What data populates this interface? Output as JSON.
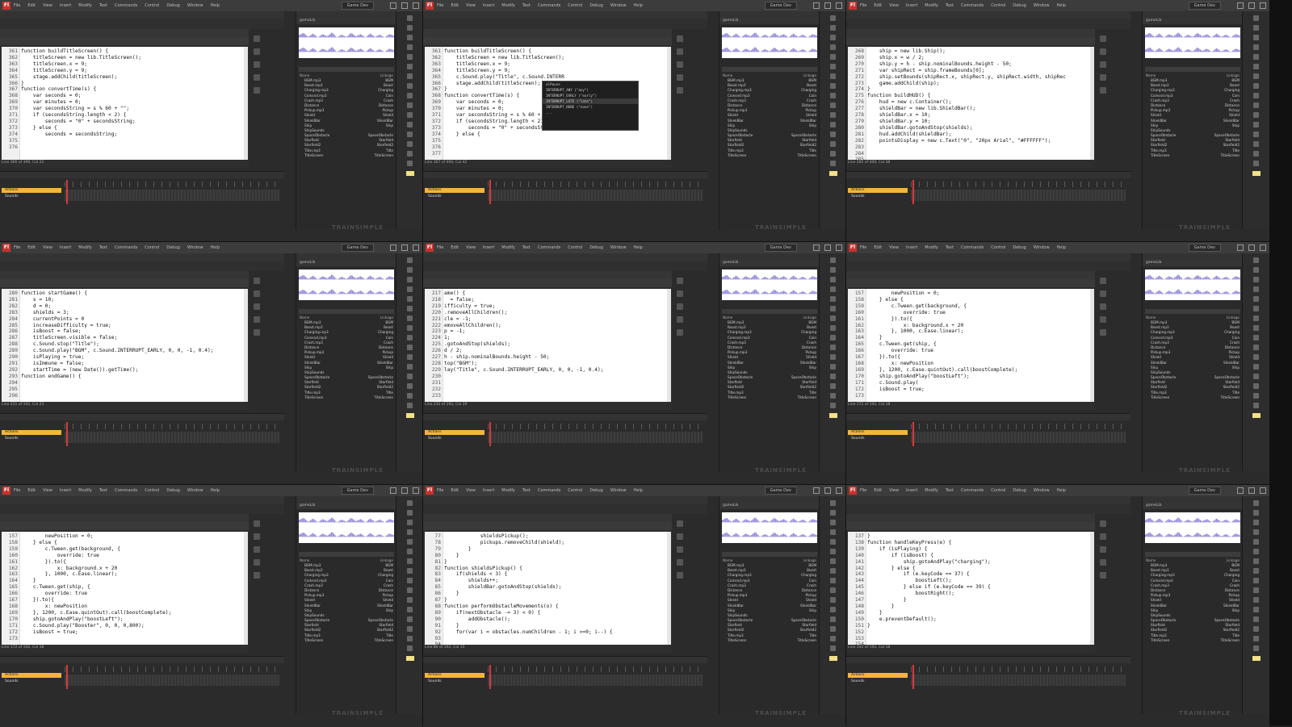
{
  "app": {
    "menu": [
      "File",
      "Edit",
      "View",
      "Insert",
      "Modify",
      "Text",
      "Commands",
      "Control",
      "Debug",
      "Window",
      "Help"
    ],
    "workspace": "Game Dev",
    "watermark": "TRAINSIMPLE",
    "accent": "#c8312c"
  },
  "tiles": [
    {
      "first_line": 361,
      "lines": [
        "",
        "function buildTitleScreen() {",
        "    titleScreen = new lib.TitleScreen();",
        "    titleScreen.x = 9;",
        "    titleScreen.y = 9;",
        "    stage.addChild(titleScreen);",
        "}",
        "",
        "function convertTime(s) {",
        "    var seconds = 0;",
        "    var minutes = 0;",
        "    var secondsString = s % 60 + \"\";",
        "    if (secondsString.length < 2) {",
        "        seconds = \"0\" + secondsString;",
        "    } else {",
        "        seconds = secondsString;"
      ],
      "status": "Line 366 of 399, Col 22"
    },
    {
      "first_line": 361,
      "lines": [
        "",
        "function buildTitleScreen() {",
        "    titleScreen = new lib.TitleScreen();",
        "    titleScreen.x = 9;",
        "    titleScreen.y = 9;",
        "    c.Sound.play(\"Title\", c.Sound.INTERR",
        "    stage.addChild(titleScreen);",
        "}",
        "",
        "",
        "function convertTime(s) {",
        "    var seconds = 0;",
        "    var minutes = 0;",
        "    var secondsString = s % 60 + \"\";",
        "    if (secondsString.length < 2) {",
        "        seconds = \"0\" + secondsString;",
        "    } else {"
      ],
      "status": "Line 367 of 400, Col 42",
      "autocomplete": [
        "alPause",
        "INTERRUPT_ANY (\"any\")",
        "INTERRUPT_EARLY (\"early\")",
        "INTERRUPT_LATE (\"late\")",
        "INTERRUPT_NONE (\"none\")",
        "..."
      ]
    },
    {
      "first_line": 268,
      "lines": [
        "    ship = new lib.Ship();",
        "    ship.x = w / 2;",
        "    ship.y = h - ship.nominalBounds.height - 50;",
        "    var shipRect = ship.frameBounds[0];",
        "    ship.setBounds(shipRect.x, shipRect.y, shipRect.width, shipRec",
        "    game.addChild(ship);",
        "}",
        "",
        "function buildHUD() {",
        "    hud = new c.Container();",
        "",
        "    shieldBar = new lib.ShieldBar();",
        "    shieldBar.x = 10;",
        "    shieldBar.y = 10;",
        "    shieldBar.gotoAndStop(shields);",
        "    hud.addChild(shieldBar);",
        "",
        "    pointsDisplay = new c.Text(\"0\", \"20px Arial\", \"#FFFFFF\");"
      ],
      "status": "Line 285 of 400, Col 48"
    },
    {
      "first_line": 280,
      "lines": [
        "",
        "",
        "function startGame() {",
        "    s = 10;",
        "    d = 0;",
        "    shields = 3;",
        "    currentPoints = 0",
        "    increaseDifficulty = true;",
        "    isBoost = false;",
        "    titleScreen.visible = false;",
        "    c.Sound.stop(\"Title\");",
        "    c.Sound.play(\"BGM\", c.Sound.INTERRUPT_EARLY, 0, 0, -1, 0.4);",
        "    isPlaying = true;",
        "    isImmune = false;",
        "    startTime = (new Date()).getTime();",
        "",
        "function endGame() {"
      ],
      "status": "Line 211 of 192, Col 23"
    },
    {
      "first_line": 217,
      "lines": [
        "ame() {",
        "  = false;",
        "",
        "ifficulty = true;",
        ".removeAllChildren();",
        "cle = -1;",
        "emoveAllChildren();",
        "p = -1;",
        "1;",
        ".gotoAndStop(shields);",
        "d / 2;",
        "h - ship.nominalBounds.height - 50;",
        "",
        "top(\"BGM\");",
        "lay(\"Title\", c.Sound.INTERRUPT_EARLY, 0, 0, -1, 0.4);",
        "",
        ""
      ],
      "status": "Line 232 of 192, Col 19"
    },
    {
      "first_line": 157,
      "lines": [
        "        newPosition = 0;",
        "    } else {",
        "        c.Tween.get(background, {",
        "            override: true",
        "        }).to({",
        "            x: background.x + 20",
        "        }, 1000, c.Ease.linear);",
        "    }",
        "",
        "    c.Tween.get(ship, {",
        "        override: true",
        "    }).to({",
        "        x: newPosition",
        "    }, 1200, c.Ease.quintOut).call(boostComplete);",
        "    ship.gotoAndPlay(\"boostLeft\");",
        "    c.Sound.play(",
        "    isBoost = true;"
      ],
      "status": "Line 172 of 192, Col 18"
    },
    {
      "first_line": 157,
      "lines": [
        "        newPosition = 0;",
        "    } else {",
        "        c.Tween.get(background, {",
        "            override: true",
        "        }).to({",
        "            x: background.x + 20",
        "        }, 1000, c.Ease.linear);",
        "    }",
        "",
        "    c.Tween.get(ship, {",
        "        override: true",
        "    }).to({",
        "        x: newPosition",
        "    }, 1200, c.Ease.quintOut).call(boostComplete);",
        "    ship.gotoAndPlay(\"boostLeft\");",
        "    c.Sound.play(\"Booster\", 0, 0, 0,800);",
        "    isBoost = true;"
      ],
      "status": "Line 172 of 192, Col 38"
    },
    {
      "first_line": 77,
      "lines": [
        "            shieldsPickup();",
        "            pickups.removeChild(shield);",
        "        }",
        "    }",
        "}",
        "",
        "function shieldsPickup() {",
        "    if(shields < 3) {",
        "        shields++;",
        "        shieldBar.gotoAndStop(shields);",
        "    }",
        "}",
        "",
        "function performObstacleMovements(o) {",
        "    if(nextObstacle -= 3) < 0) {",
        "        addObstacle();",
        "    }",
        "",
        "    for(var i = obstacles.numChildren - 1; i >=0; i--) {"
      ],
      "status": "Line 86 of 192, Col 15"
    },
    {
      "first_line": 137,
      "lines": [
        "}",
        "",
        "function handleKeyPress(e) {",
        "    if (isPlaying) {",
        "        if (isBoost) {",
        "            ship.gotoAndPlay(\"charging\");",
        "",
        "        } else {",
        "            if (e.keyCode == 37) {",
        "                boostLeft();",
        "            } else if (e.keyCode == 39) {",
        "                boostRight();",
        "            }",
        "        }",
        "    }",
        "    e.preventDefault();",
        "}",
        ""
      ],
      "status": "Line 141 of 192, Col 18"
    }
  ],
  "library": {
    "file": "gameLib",
    "header_name": "Name",
    "header_linkage": "Linkage",
    "items": [
      {
        "name": "BGM.mp3",
        "linkage": "BGM"
      },
      {
        "name": "Boost.mp3",
        "linkage": "Boost"
      },
      {
        "name": "Charging.mp3",
        "linkage": "Charging"
      },
      {
        "name": "Coinsnd.mp3",
        "linkage": "Coin"
      },
      {
        "name": "Crash.mp3",
        "linkage": "Crash"
      },
      {
        "name": "Distance",
        "linkage": "Distance"
      },
      {
        "name": "Pickup.mp3",
        "linkage": "Pickup"
      },
      {
        "name": "Shield",
        "linkage": "Shield"
      },
      {
        "name": "ShieldBar",
        "linkage": "ShieldBar"
      },
      {
        "name": "Ship",
        "linkage": "Ship"
      },
      {
        "name": "ShipSounds",
        "linkage": ""
      },
      {
        "name": "SpaceObstacle",
        "linkage": "SpaceObstacle"
      },
      {
        "name": "Starfield",
        "linkage": "Starfield"
      },
      {
        "name": "Starfield2",
        "linkage": "Starfield2"
      },
      {
        "name": "Title.mp3",
        "linkage": "Title"
      },
      {
        "name": "TitleScreen",
        "linkage": "TitleScreen"
      }
    ]
  },
  "timeline": {
    "layers": [
      "Actions",
      "Sounds"
    ]
  }
}
